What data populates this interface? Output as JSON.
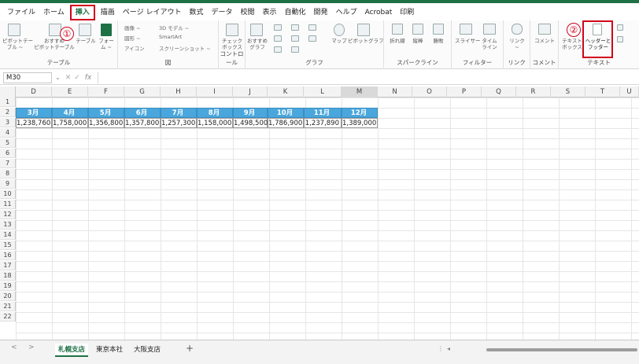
{
  "ribbon_tabs": [
    "ファイル",
    "ホーム",
    "挿入",
    "描画",
    "ページ レイアウト",
    "数式",
    "データ",
    "校閲",
    "表示",
    "自動化",
    "開発",
    "ヘルプ",
    "Acrobat",
    "印刷"
  ],
  "active_tab": "挿入",
  "groups": {
    "table": "テーブル",
    "figure": "図",
    "control": "コントロール",
    "graph": "グラフ",
    "sparkline": "スパークライン",
    "filter": "フィルター",
    "link": "リンク",
    "comment": "コメント",
    "text": "テキスト"
  },
  "items": {
    "pivot_table": "ピボットテー\nブル ~",
    "rec_pivot": "おすすめ\nピボットテーブル",
    "table": "テーブル",
    "form": "フォー\nム ~",
    "image": "画像 ~",
    "shapes": "図形 ~",
    "icons": "アイコン",
    "model3d": "3D モデル ~",
    "smartart": "SmartArt",
    "screenshot": "スクリーンショット ~",
    "checkbox": "チェック\nボックス",
    "rec_chart": "おすすめ\nグラフ",
    "map": "マップ",
    "pivot_chart": "ピボットグラフ",
    "spark_line": "折れ線",
    "spark_column": "縦棒",
    "spark_winloss": "勝敗",
    "slicer": "スライサー",
    "timeline": "タイム\nライン",
    "link": "リンク\n~",
    "comment": "コメント",
    "textbox": "テキスト\nボックス",
    "header_footer": "ヘッダーと\nフッター"
  },
  "annotations": [
    "①",
    "②"
  ],
  "name_box": "M30",
  "fx": "fx",
  "columns": [
    "D",
    "E",
    "F",
    "G",
    "H",
    "I",
    "J",
    "K",
    "L",
    "M",
    "N",
    "O",
    "P",
    "Q",
    "R",
    "S",
    "T",
    "U"
  ],
  "selected_column": "M",
  "rows": [
    "1",
    "2",
    "3",
    "4",
    "5",
    "6",
    "7",
    "8",
    "9",
    "10",
    "11",
    "12",
    "13",
    "14",
    "15",
    "16",
    "17",
    "18",
    "19",
    "20",
    "21",
    "22"
  ],
  "table": {
    "headers": [
      "3月",
      "4月",
      "5月",
      "6月",
      "7月",
      "8月",
      "9月",
      "10月",
      "11月",
      "12月"
    ],
    "values": [
      "1,238,760",
      "1,758,000",
      "1,356,800",
      "1,357,800",
      "1,257,300",
      "1,158,000",
      "1,498,500",
      "1,786,900",
      "1,237,890",
      "1,389,000"
    ]
  },
  "sheets": [
    "札幌支店",
    "東京本社",
    "大阪支店"
  ],
  "active_sheet": "札幌支店",
  "nav": {
    "prev": "<",
    "next": ">",
    "add": "+"
  }
}
